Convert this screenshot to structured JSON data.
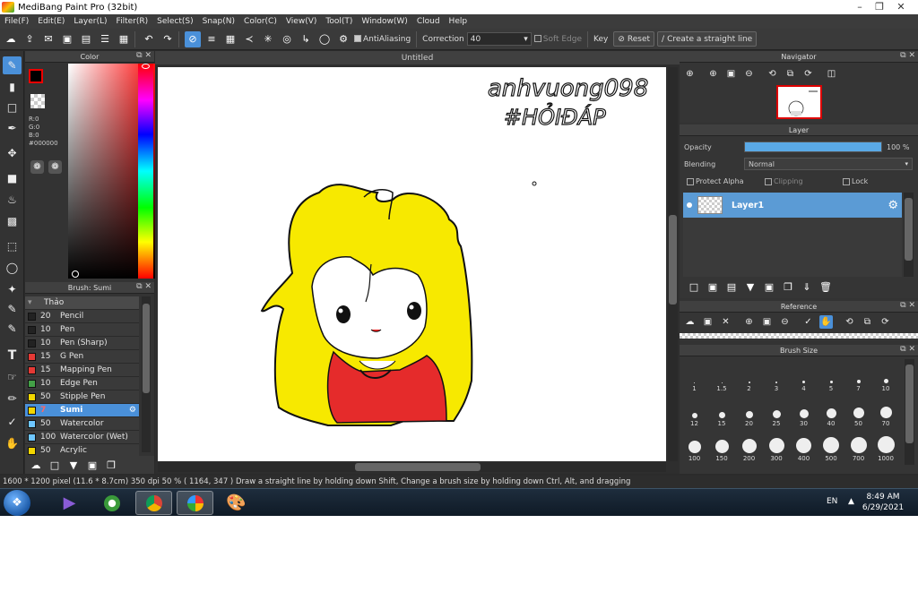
{
  "window": {
    "title": "MediBang Paint Pro (32bit)"
  },
  "menu": [
    "File(F)",
    "Edit(E)",
    "Layer(L)",
    "Filter(R)",
    "Select(S)",
    "Snap(N)",
    "Color(C)",
    "View(V)",
    "Tool(T)",
    "Window(W)",
    "Cloud",
    "Help"
  ],
  "toolbar": {
    "antialiasing_label": "AntiAliasing",
    "correction_label": "Correction",
    "correction_value": "40",
    "soft_edge_label": "Soft Edge",
    "key_label": "Key",
    "reset_label": "Reset",
    "straight_line_label": "Create a straight line"
  },
  "color_panel": {
    "title": "Color",
    "r": "R:0",
    "g": "G:0",
    "b": "B:0",
    "hex": "#000000",
    "primary_color": "#000000",
    "secondary_color": "#ffffff"
  },
  "brush_panel": {
    "title": "Brush: Sumi",
    "group": "Thảo",
    "items": [
      {
        "size": "20",
        "name": "Pencil",
        "color": "#222222",
        "selected": false
      },
      {
        "size": "10",
        "name": "Pen",
        "color": "#222222",
        "selected": false
      },
      {
        "size": "10",
        "name": "Pen (Sharp)",
        "color": "#222222",
        "selected": false
      },
      {
        "size": "15",
        "name": "G Pen",
        "color": "#e53935",
        "selected": false
      },
      {
        "size": "15",
        "name": "Mapping Pen",
        "color": "#e53935",
        "selected": false
      },
      {
        "size": "10",
        "name": "Edge Pen",
        "color": "#43a047",
        "selected": false
      },
      {
        "size": "50",
        "name": "Stipple Pen",
        "color": "#f2d600",
        "selected": false
      },
      {
        "size": "7",
        "name": "Sumi",
        "color": "#f2d600",
        "selected": true
      },
      {
        "size": "50",
        "name": "Watercolor",
        "color": "#6ec6ff",
        "selected": false
      },
      {
        "size": "100",
        "name": "Watercolor (Wet)",
        "color": "#6ec6ff",
        "selected": false
      },
      {
        "size": "50",
        "name": "Acrylic",
        "color": "#f2d600",
        "selected": false
      }
    ]
  },
  "canvas": {
    "tab_title": "Untitled",
    "handwriting_line1": "anhvuong098",
    "handwriting_line2": "#HỎIĐÁP"
  },
  "navigator": {
    "title": "Navigator"
  },
  "layer_panel": {
    "title": "Layer",
    "opacity_label": "Opacity",
    "opacity_value": "100 %",
    "opacity_fraction": 1.0,
    "blending_label": "Blending",
    "blending_value": "Normal",
    "protect_alpha_label": "Protect Alpha",
    "clipping_label": "Clipping",
    "lock_label": "Lock",
    "layers": [
      {
        "name": "Layer1"
      }
    ]
  },
  "reference_panel": {
    "title": "Reference"
  },
  "brush_size_panel": {
    "title": "Brush Size",
    "sizes": [
      "1",
      "1.5",
      "2",
      "3",
      "4",
      "5",
      "7",
      "10",
      "12",
      "15",
      "20",
      "25",
      "30",
      "40",
      "50",
      "70",
      "100",
      "150",
      "200",
      "300",
      "400",
      "500",
      "700",
      "1000"
    ]
  },
  "status": {
    "canvas_size": "1600 * 1200 pixel",
    "physical_size": "(11.6 * 8.7cm)",
    "dpi": "350 dpi",
    "zoom": "50 %",
    "coords": "( 1164, 347 )",
    "hint": "Draw a straight line by holding down Shift, Change a brush size by holding down Ctrl, Alt, and dragging"
  },
  "taskbar": {
    "language": "EN",
    "time": "8:49 AM",
    "date": "6/29/2021"
  },
  "colors": {
    "accent": "#4a90d9",
    "hair": "#f7e900",
    "shirt": "#e52b2b"
  }
}
